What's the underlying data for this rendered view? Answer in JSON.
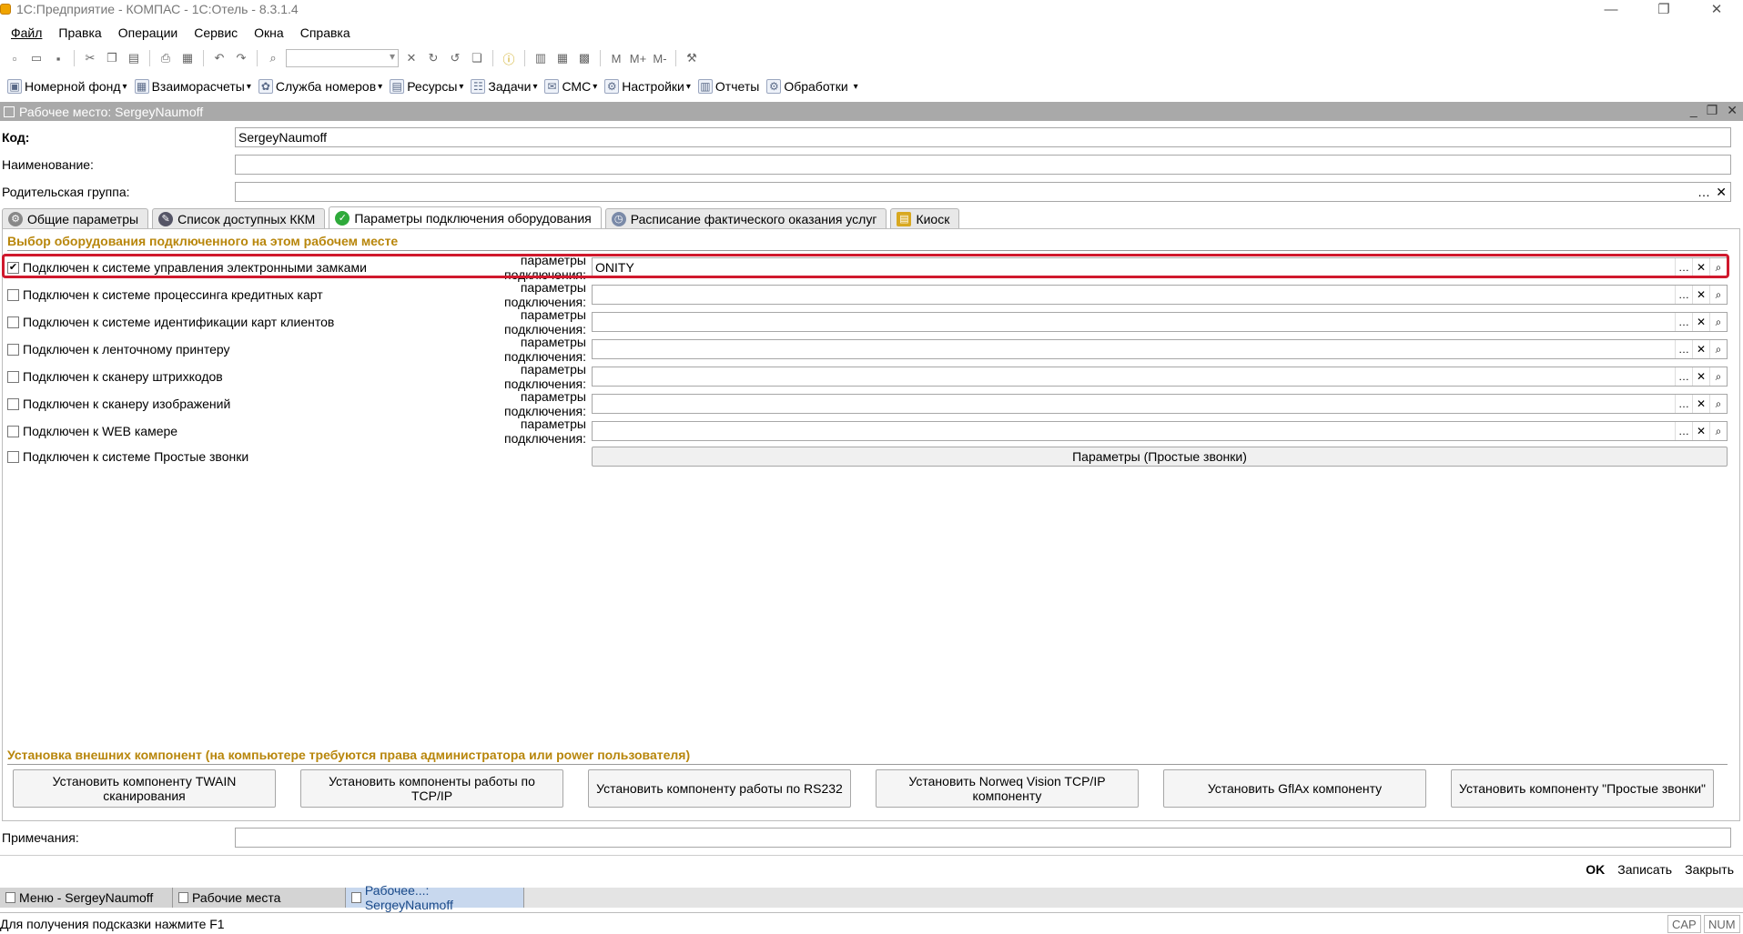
{
  "window": {
    "title": "1С:Предприятие - КОМПАС - 1С:Отель - 8.3.1.4",
    "minimize": "—",
    "restore": "❐",
    "close": "✕"
  },
  "menu": [
    "Файл",
    "Правка",
    "Операции",
    "Сервис",
    "Окна",
    "Справка"
  ],
  "toolbar2": [
    {
      "label": "Номерной фонд",
      "icon": "room-fund-icon",
      "dropdown": true
    },
    {
      "label": "Взаиморасчеты",
      "icon": "settlements-icon",
      "dropdown": true
    },
    {
      "label": "Служба номеров",
      "icon": "housekeeping-icon",
      "dropdown": true
    },
    {
      "label": "Ресурсы",
      "icon": "resources-icon",
      "dropdown": true
    },
    {
      "label": "Задачи",
      "icon": "tasks-icon",
      "dropdown": true
    },
    {
      "label": "СМС",
      "icon": "sms-icon",
      "dropdown": true
    },
    {
      "label": "Настройки",
      "icon": "settings-icon",
      "dropdown": true
    },
    {
      "label": "Отчеты",
      "icon": "reports-icon",
      "dropdown": false
    },
    {
      "label": "Обработки",
      "icon": "processing-icon",
      "dropdown": false
    }
  ],
  "form": {
    "title": "Рабочее место: SergeyNaumoff",
    "code_label": "Код:",
    "code_value": "SergeyNaumoff",
    "name_label": "Наименование:",
    "name_value": "",
    "parent_label": "Родительская группа:",
    "parent_value": "",
    "tabs": [
      {
        "label": "Общие параметры",
        "icon": "gear-icon",
        "active": false
      },
      {
        "label": "Список доступных ККМ",
        "icon": "cash-register-icon",
        "active": false
      },
      {
        "label": "Параметры подключения оборудования",
        "icon": "check-circle-icon",
        "active": true
      },
      {
        "label": "Расписание фактического оказания услуг",
        "icon": "clock-icon",
        "active": false
      },
      {
        "label": "Киоск",
        "icon": "kiosk-icon",
        "active": false
      }
    ],
    "section_title": "Выбор оборудования подключенного на этом рабочем месте",
    "param_label": "параметры подключения:",
    "equipment": [
      {
        "label": "Подключен к системе управления электронными замками",
        "checked": true,
        "value": "ONITY"
      },
      {
        "label": "Подключен к системе процессинга кредитных карт",
        "checked": false,
        "value": ""
      },
      {
        "label": "Подключен к системе идентификации карт клиентов",
        "checked": false,
        "value": ""
      },
      {
        "label": "Подключен к ленточному принтеру",
        "checked": false,
        "value": ""
      },
      {
        "label": "Подключен к сканеру штрихкодов",
        "checked": false,
        "value": ""
      },
      {
        "label": "Подключен к сканеру изображений",
        "checked": false,
        "value": ""
      },
      {
        "label": "Подключен к WEB камере",
        "checked": false,
        "value": ""
      }
    ],
    "simple_calls_label": "Подключен к системе Простые звонки",
    "simple_calls_button": "Параметры (Простые звонки)",
    "install_title": "Установка внешних компонент (на компьютере требуются права администратора или power пользователя)",
    "install_buttons": [
      "Установить компоненту TWAIN сканирования",
      "Установить компоненты работы по TCP/IP",
      "Установить компоненту работы по RS232",
      "Установить Norweq Vision TCP/IP компоненту",
      "Установить GflAx компоненту",
      "Установить компоненту \"Простые звонки\""
    ],
    "notes_label": "Примечания:",
    "notes_value": "",
    "ok_label": "OK",
    "save_label": "Записать",
    "close_label": "Закрыть"
  },
  "taskbar": [
    {
      "label": "Меню - SergeyNaumoff",
      "active": false
    },
    {
      "label": "Рабочие места",
      "active": false
    },
    {
      "label": "Рабочее...: SergeyNaumoff",
      "active": true
    }
  ],
  "status": {
    "hint": "Для получения подсказки нажмите F1",
    "cap": "CAP",
    "num": "NUM"
  },
  "highlight_color": "#d0192d",
  "section_color": "#b8860b"
}
